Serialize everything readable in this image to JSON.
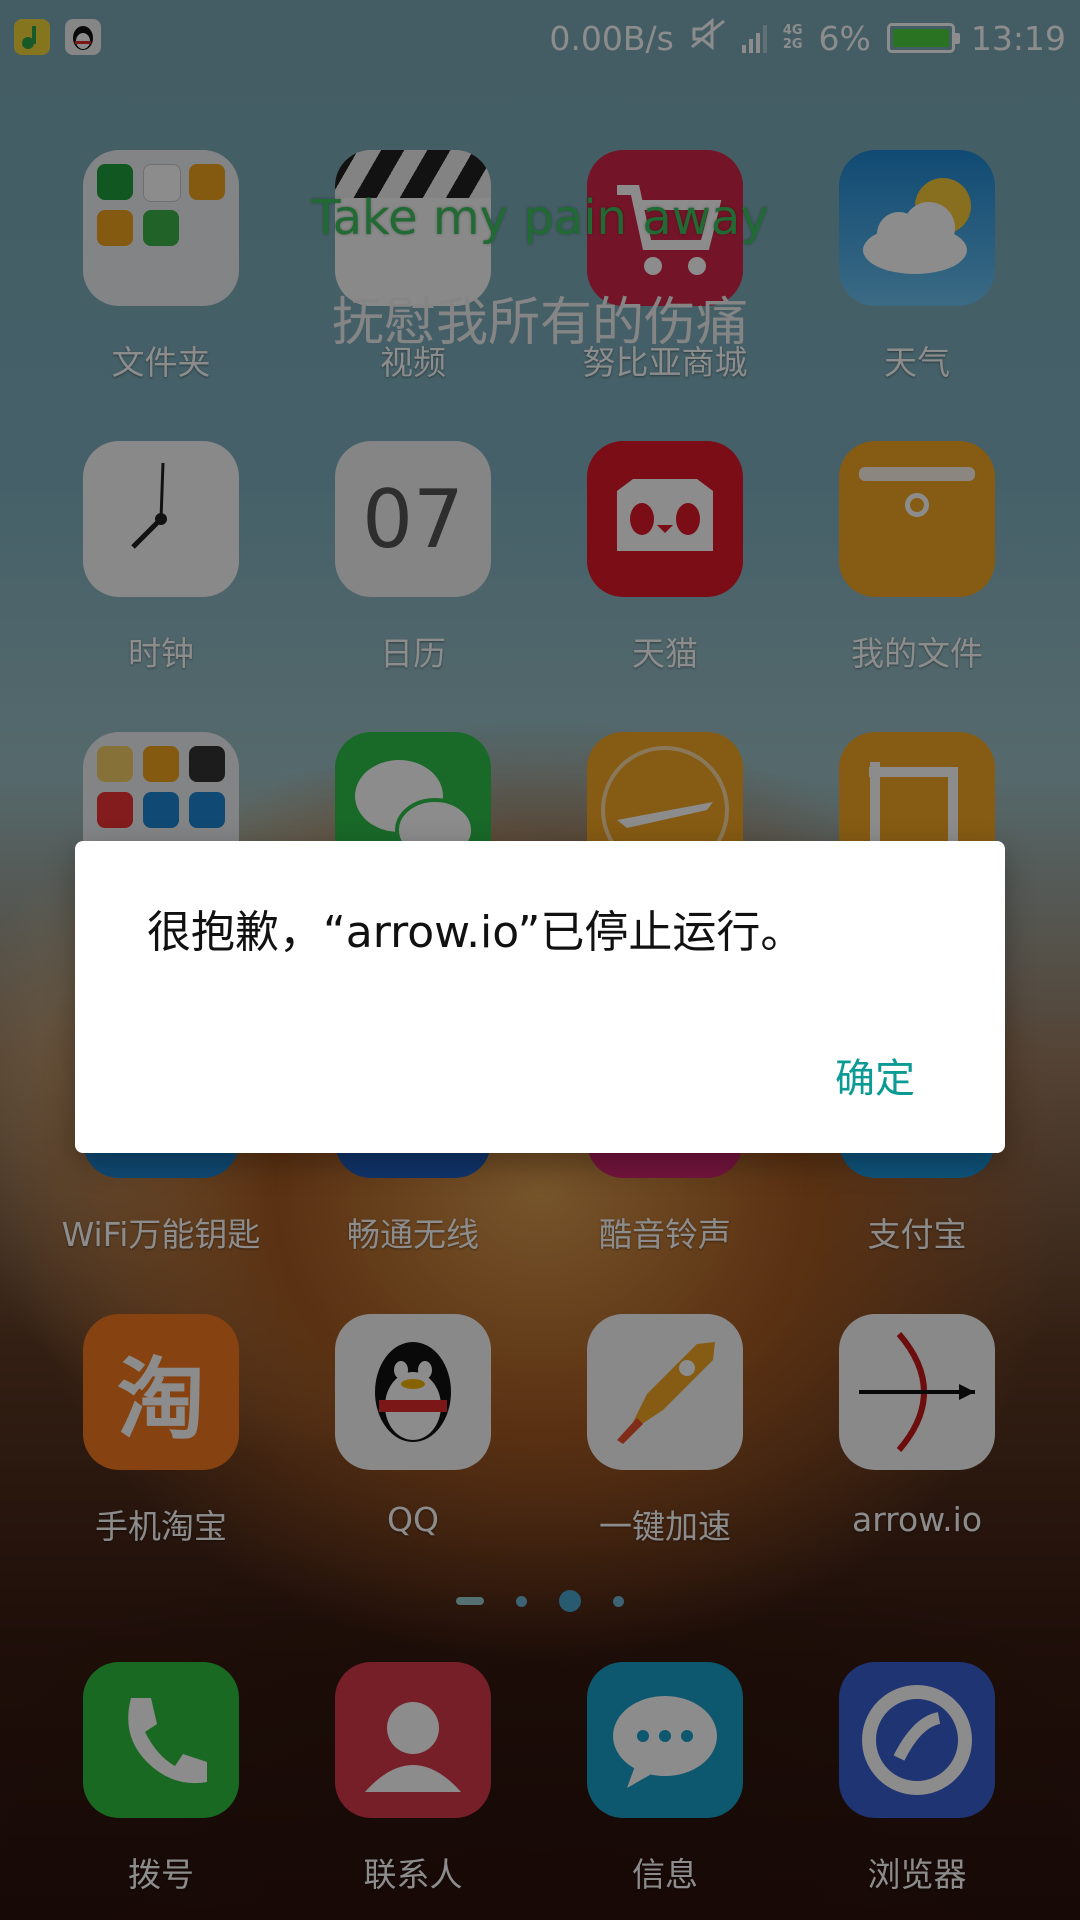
{
  "status_bar": {
    "net_speed": "0.00B/s",
    "net_type_top": "4G",
    "net_type_bottom": "2G",
    "battery": "6%",
    "battery_level": 0.06,
    "time": "13:19"
  },
  "lyrics": {
    "line_en": "Take my pain away",
    "line_zh": "抚慰我所有的伤痛"
  },
  "apps": {
    "row1": [
      "文件夹",
      "视频",
      "努比亚商城",
      "天气"
    ],
    "row2": [
      "时钟",
      "日历",
      "天猫",
      "我的文件"
    ],
    "row4": [
      "WiFi万能钥匙",
      "畅通无线",
      "酷音铃声",
      "支付宝"
    ],
    "row5": [
      "手机淘宝",
      "QQ",
      "一键加速",
      "arrow.io"
    ],
    "dock": [
      "拨号",
      "联系人",
      "信息",
      "浏览器"
    ],
    "calendar_day": "07",
    "taobao_glyph": "淘"
  },
  "dialog": {
    "message": "很抱歉，“arrow.io”已停止运行。",
    "ok_label": "确定"
  },
  "colors": {
    "dialog_accent": "#0b9a94",
    "lyric_green": "#3cc25d",
    "dim_overlay": "rgba(0,0,0,0.45)"
  }
}
